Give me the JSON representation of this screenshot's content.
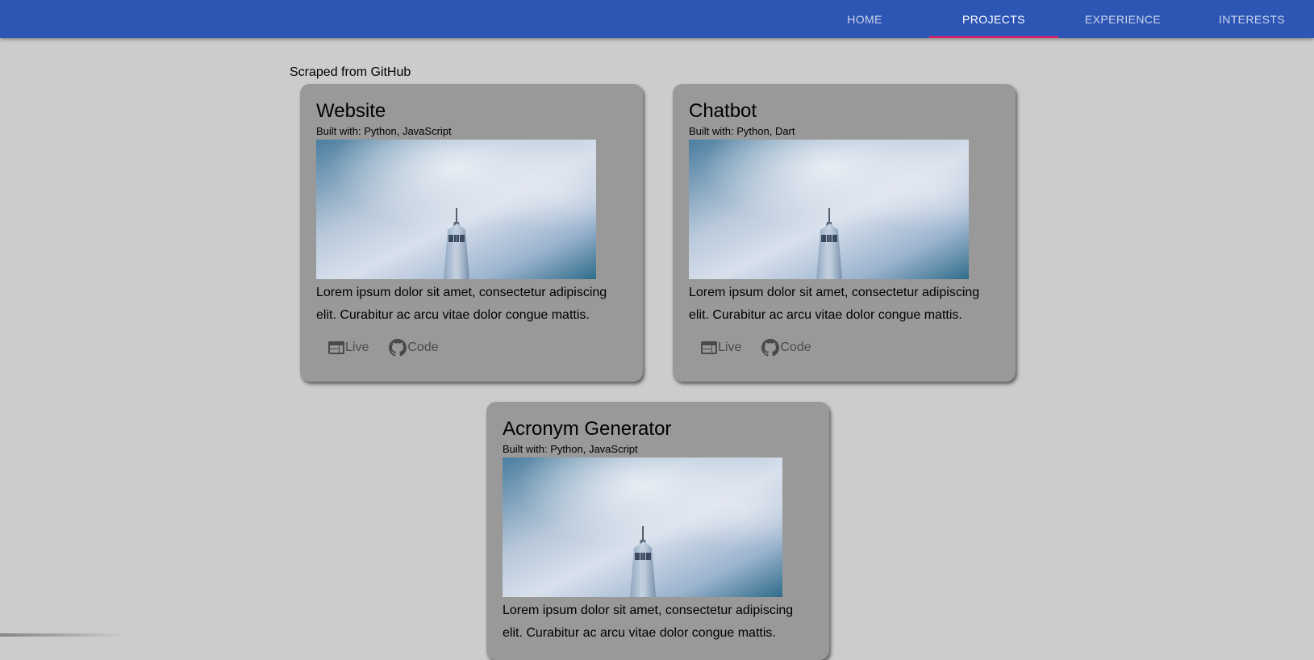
{
  "nav": {
    "tabs": [
      {
        "label": "HOME",
        "active": false
      },
      {
        "label": "PROJECTS",
        "active": true
      },
      {
        "label": "EXPERIENCE",
        "active": false
      },
      {
        "label": "INTERESTS",
        "active": false
      }
    ]
  },
  "colors": {
    "appbar": "#2d55b4",
    "indicator": "#e91e63",
    "background": "#cccccc",
    "card": "#999999"
  },
  "main": {
    "subtitle": "Scraped from GitHub",
    "projects": [
      {
        "title": "Website",
        "built_with": "Built with: Python, JavaScript",
        "description": "Lorem ipsum dolor sit amet, consectetur adipiscing elit. Curabitur ac arcu vitae dolor congue mattis.",
        "live_label": "Live",
        "live_icon": "web-icon",
        "code_label": "Code",
        "code_icon": "github-icon"
      },
      {
        "title": "Chatbot",
        "built_with": "Built with: Python, Dart",
        "description": "Lorem ipsum dolor sit amet, consectetur adipiscing elit. Curabitur ac arcu vitae dolor congue mattis.",
        "live_label": "Live",
        "live_icon": "web-icon",
        "code_label": "Code",
        "code_icon": "github-icon"
      },
      {
        "title": "Acronym Generator",
        "built_with": "Built with: Python, JavaScript",
        "description": "Lorem ipsum dolor sit amet, consectetur adipiscing elit. Curabitur ac arcu vitae dolor congue mattis."
      }
    ]
  }
}
